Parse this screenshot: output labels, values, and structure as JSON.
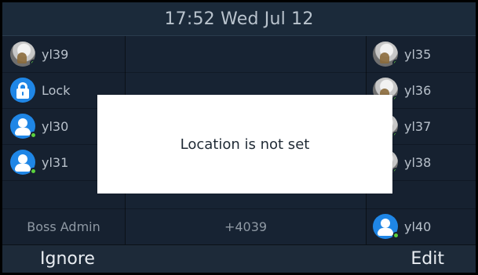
{
  "header": {
    "time_date": "17:52 Wed Jul 12"
  },
  "left_keys": [
    {
      "label": "yl39",
      "avatar": "photo-avatar-icon",
      "presence": "presence-online-dot"
    },
    {
      "label": "Lock",
      "avatar": "lock-icon",
      "presence": ""
    },
    {
      "label": "yl30",
      "avatar": "person-avatar-icon",
      "presence": "presence-online-dot"
    },
    {
      "label": "yl31",
      "avatar": "person-avatar-icon",
      "presence": "presence-online-dot"
    }
  ],
  "left_bottom_label": "Boss Admin",
  "mid_bottom_label": "+4039",
  "right_keys": [
    {
      "label": "yl35",
      "avatar": "photo-avatar-icon",
      "presence": "presence-online-dot"
    },
    {
      "label": "yl36",
      "avatar": "photo-avatar-icon",
      "presence": "presence-online-dot"
    },
    {
      "label": "yl37",
      "avatar": "photo-avatar-icon",
      "presence": "presence-online-dot"
    },
    {
      "label": "yl38",
      "avatar": "photo-avatar-icon",
      "presence": "presence-online-dot"
    },
    {
      "label": "yl40",
      "avatar": "person-avatar-icon",
      "presence": "presence-online-dot"
    }
  ],
  "dialog": {
    "message": "Location is not set"
  },
  "softkeys": {
    "left": "Ignore",
    "right": "Edit"
  },
  "colors": {
    "accent_blue": "#1f86e6",
    "presence_green": "#5bd13d"
  }
}
